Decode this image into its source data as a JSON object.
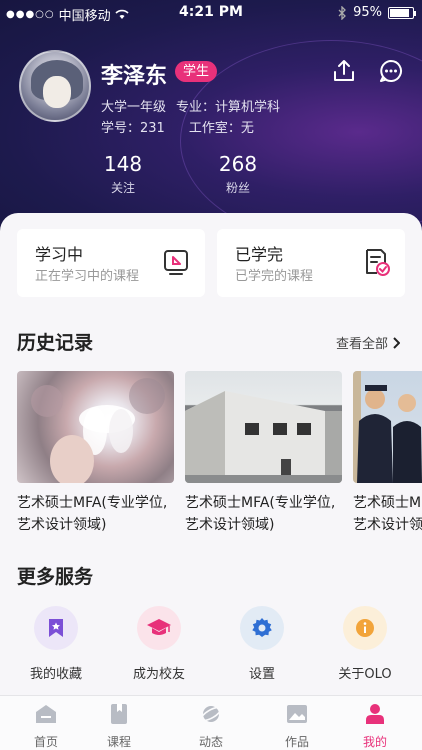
{
  "status_bar": {
    "carrier": "中国移动",
    "signal": "●●●○○",
    "time": "4:21 PM",
    "battery": "95%"
  },
  "profile": {
    "name": "李泽东",
    "role_badge": "学生",
    "grade": "大学一年级",
    "major": "专业：计算机学科",
    "student_id": "学号：231",
    "studio": "工作室：无",
    "stats": [
      {
        "value": "148",
        "label": "关注"
      },
      {
        "value": "268",
        "label": "粉丝"
      }
    ]
  },
  "learning_cards": [
    {
      "title": "学习中",
      "subtitle": "正在学习中的课程"
    },
    {
      "title": "已学完",
      "subtitle": "已学完的课程"
    }
  ],
  "history": {
    "title": "历史记录",
    "see_all": "查看全部",
    "items": [
      {
        "line1": "艺术硕士MFA(专业学位,",
        "line2": "艺术设计领域)"
      },
      {
        "line1": "艺术硕士MFA(专业学位,",
        "line2": "艺术设计领域)"
      },
      {
        "line1": "艺术硕士MFA(专业学位,",
        "line2": "艺术设计领域)"
      }
    ]
  },
  "services": {
    "title": "更多服务",
    "items": [
      {
        "label": "我的收藏",
        "icon": "bookmark-star-icon",
        "bg": "#ece6f8",
        "color": "#7b4fd6"
      },
      {
        "label": "成为校友",
        "icon": "graduation-cap-icon",
        "bg": "#fbe3ea",
        "color": "#e8317a"
      },
      {
        "label": "设置",
        "icon": "gear-icon",
        "bg": "#e2ebf5",
        "color": "#2f6fd4"
      },
      {
        "label": "关于OLO",
        "icon": "info-icon",
        "bg": "#fcefd9",
        "color": "#f2a43a"
      }
    ]
  },
  "tabbar": {
    "items": [
      {
        "label": "首页",
        "icon": "home-icon"
      },
      {
        "label": "课程",
        "icon": "book-icon"
      },
      {
        "label": "动态",
        "icon": "planet-icon"
      },
      {
        "label": "作品",
        "icon": "image-icon"
      },
      {
        "label": "我的",
        "icon": "user-icon",
        "active": true
      }
    ]
  },
  "colors": {
    "accent": "#e8317a",
    "hero_dark": "#1d1a4d"
  }
}
